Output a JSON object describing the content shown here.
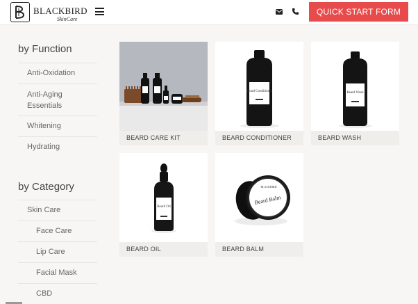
{
  "brand": {
    "name": "BLACKBIRD",
    "tagline": "SkinCare"
  },
  "header": {
    "cta_label": "QUICK START FORM",
    "accent": "#e84b4b"
  },
  "sidebar": {
    "function_heading": "by Function",
    "function_items": [
      "Anti-Oxidation",
      "Anti-Aging Essentials",
      "Whitening",
      "Hydrating"
    ],
    "category_heading": "by Category",
    "category_items": [
      "Skin Care",
      "Face Care",
      "Lip Care",
      "Facial Mask",
      "CBD"
    ]
  },
  "products": [
    {
      "name": "BEARD CARE KIT"
    },
    {
      "name": "BEARD CONDITIONER",
      "label": "Beard Conditioner"
    },
    {
      "name": "BEARD WASH",
      "label": "Beard Wash"
    },
    {
      "name": "BEARD OIL",
      "label": "Beard Oil"
    },
    {
      "name": "BEARD BALM",
      "label": "Beard Balm",
      "brand_mark": "BLACKBIRD"
    }
  ]
}
